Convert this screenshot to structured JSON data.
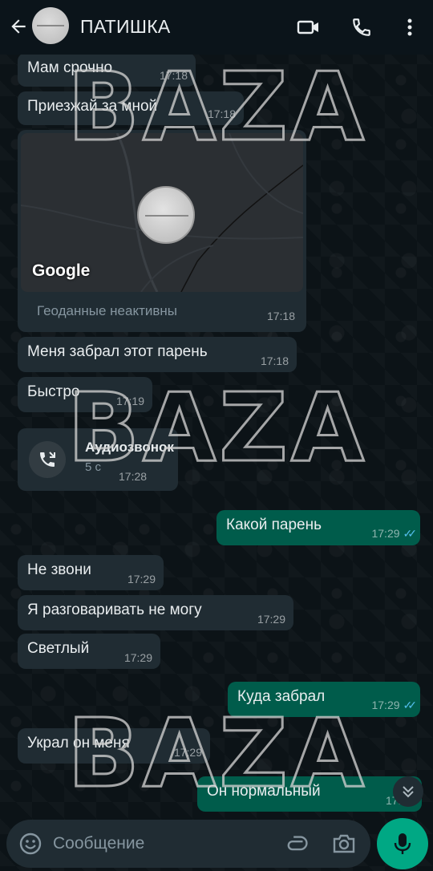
{
  "header": {
    "contact_name": "ПАТИШКА",
    "icons": [
      "back-arrow-icon",
      "video-call-icon",
      "phone-icon",
      "more-vert-icon"
    ]
  },
  "messages": [
    {
      "dir": "in",
      "text": "Мам срочно",
      "time": "17:18"
    },
    {
      "dir": "in",
      "text": "Приезжай за мной",
      "time": "17:18"
    },
    {
      "dir": "in",
      "type": "location",
      "logo": "Google",
      "caption": "Геоданные неактивны",
      "time": "17:18"
    },
    {
      "dir": "in",
      "text": "Меня забрал этот парень",
      "time": "17:18"
    },
    {
      "dir": "in",
      "text": "Быстро",
      "time": "17:19"
    },
    {
      "dir": "in",
      "type": "call",
      "title": "Аудиозвонок",
      "duration": "5 с",
      "time": "17:28"
    },
    {
      "dir": "out",
      "text": "Какой парень",
      "time": "17:29",
      "status": "read"
    },
    {
      "dir": "in",
      "text": "Не звони",
      "time": "17:29"
    },
    {
      "dir": "in",
      "text": "Я разговаривать не могу",
      "time": "17:29"
    },
    {
      "dir": "in",
      "text": "Светлый",
      "time": "17:29"
    },
    {
      "dir": "out",
      "text": "Куда забрал",
      "time": "17:29",
      "status": "read"
    },
    {
      "dir": "in",
      "text": "Украл он меня",
      "time": "17:29"
    },
    {
      "dir": "out",
      "text": "Он нормальный",
      "time": "17:29"
    }
  ],
  "watermark": "BAZA",
  "composer": {
    "placeholder": "Сообщение"
  },
  "colors": {
    "background": "#0b141a",
    "incoming_bubble": "#202c33",
    "outgoing_bubble": "#005c4b",
    "accent": "#00a884",
    "read_ticks": "#53bdeb"
  }
}
